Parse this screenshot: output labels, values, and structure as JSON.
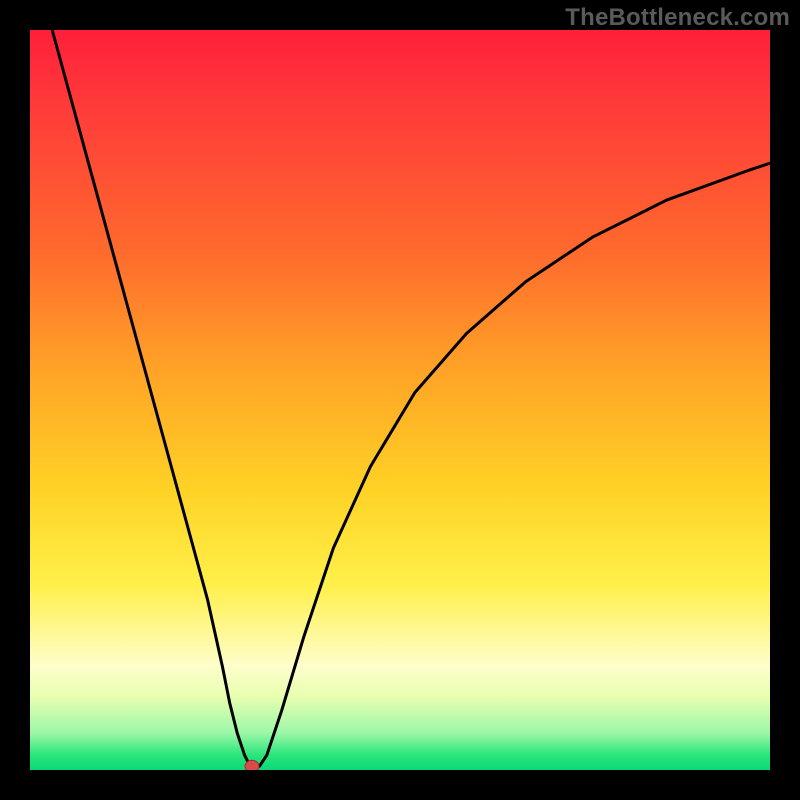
{
  "watermark": "TheBottleneck.com",
  "chart_data": {
    "type": "line",
    "title": "",
    "xlabel": "",
    "ylabel": "",
    "x_range": [
      0,
      100
    ],
    "y_range": [
      0,
      100
    ],
    "series": [
      {
        "name": "bottleneck-curve",
        "x": [
          3,
          6,
          9,
          12,
          15,
          18,
          21,
          24,
          26,
          27,
          28,
          29,
          29.5,
          30,
          31,
          32,
          34,
          37,
          41,
          46,
          52,
          59,
          67,
          76,
          86,
          97,
          100
        ],
        "y": [
          100,
          89,
          78,
          67,
          56,
          45,
          34,
          23,
          14,
          9,
          5,
          2,
          1,
          0.5,
          0.5,
          2,
          8,
          18,
          30,
          41,
          51,
          59,
          66,
          72,
          77,
          81,
          82
        ]
      }
    ],
    "marker": {
      "x": 30,
      "y": 0.5,
      "name": "optimal-point"
    },
    "gradient_stops": [
      {
        "pos": 0.0,
        "color": "#ff1f3a"
      },
      {
        "pos": 0.3,
        "color": "#ff6a2d"
      },
      {
        "pos": 0.62,
        "color": "#ffd225"
      },
      {
        "pos": 0.86,
        "color": "#fdfecb"
      },
      {
        "pos": 0.98,
        "color": "#29e67a"
      },
      {
        "pos": 1.0,
        "color": "#0bd977"
      }
    ]
  }
}
